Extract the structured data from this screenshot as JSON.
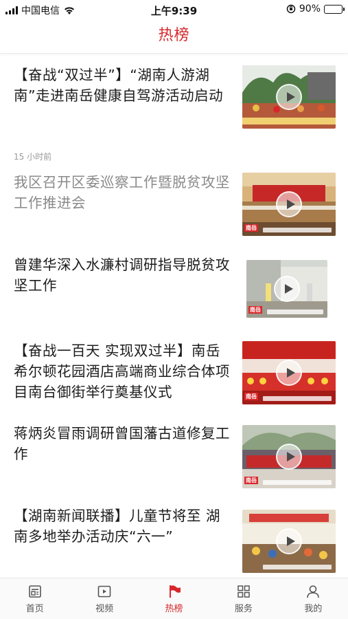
{
  "status_bar": {
    "carrier": "中国电信",
    "time": "上午9:39",
    "battery": "90%",
    "battery_level": 0.9
  },
  "header": {
    "title": "热榜"
  },
  "news": [
    {
      "title": "【奋战“双过半”】“湖南人游湖南”走进南岳健康自驾游活动启动",
      "time": "15 小时前",
      "read": false,
      "thumb": "outdoor-event-thumbnail"
    },
    {
      "title": "我区召开区委巡察工作暨脱贫攻坚工作推进会",
      "read": true,
      "thumb": "meeting-hall-thumbnail"
    },
    {
      "title": "曾建华深入水濂村调研指导脱贫攻坚工作",
      "read": false,
      "thumb": "village-visit-thumbnail"
    },
    {
      "title": "【奋战一百天 实现双过半】南岳希尔顿花园酒店高端商业综合体项目南台御街举行奠基仪式",
      "read": false,
      "thumb": "groundbreaking-ceremony-thumbnail"
    },
    {
      "title": "蒋炳炎冒雨调研曾国藩古道修复工作",
      "read": false,
      "thumb": "group-photo-banner-thumbnail"
    },
    {
      "title": "【湖南新闻联播】儿童节将至 湖南多地举办活动庆“六一”",
      "read": false,
      "thumb": "classroom-children-thumbnail"
    }
  ],
  "tabs": [
    {
      "label": "首页",
      "icon": "home-icon",
      "active": false
    },
    {
      "label": "视频",
      "icon": "video-icon",
      "active": false
    },
    {
      "label": "热榜",
      "icon": "flag-icon",
      "active": true
    },
    {
      "label": "服务",
      "icon": "grid-icon",
      "active": false
    },
    {
      "label": "我的",
      "icon": "person-icon",
      "active": false
    }
  ],
  "colors": {
    "accent": "#d8272b",
    "read_text": "#8a8a8a",
    "text": "#1c1c1c"
  }
}
